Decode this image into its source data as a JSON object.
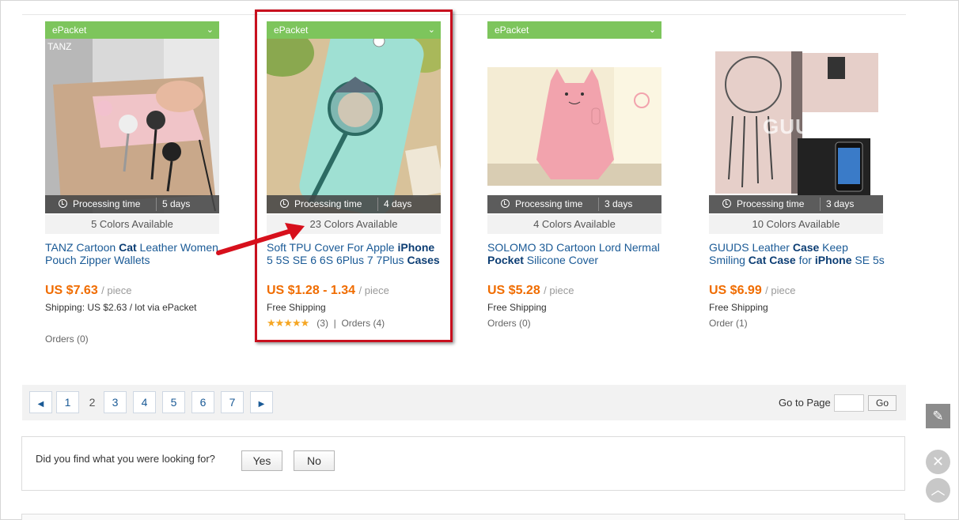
{
  "products": [
    {
      "badge": "ePacket",
      "processing_label": "Processing time",
      "processing_days": "5 days",
      "colors": "5 Colors Available",
      "title_parts": [
        {
          "text": "TANZ Cartoon ",
          "bold": false
        },
        {
          "text": "Cat",
          "bold": true
        },
        {
          "text": " Leather Women Pouch Zipper Wallets",
          "bold": false
        }
      ],
      "price": "US $7.63",
      "unit": "/ piece",
      "shipping": "Shipping: US $2.63 / lot via ePacket",
      "orders": "Orders (0)",
      "image_brand_text": "TANZ"
    },
    {
      "badge": "ePacket",
      "processing_label": "Processing time",
      "processing_days": "4 days",
      "colors": "23 Colors Available",
      "title_parts": [
        {
          "text": "Soft TPU Cover For Apple ",
          "bold": false
        },
        {
          "text": "iPhone",
          "bold": true
        },
        {
          "text": " 5 5S SE 6 6S 6Plus 7 7Plus ",
          "bold": false
        },
        {
          "text": "Cases",
          "bold": true
        }
      ],
      "price": "US $1.28 - 1.34",
      "unit": "/ piece",
      "shipping": "Free Shipping",
      "stars": "★★★★★",
      "rating_count": "(3)",
      "rating_separator": "|",
      "orders": "Orders (4)"
    },
    {
      "badge": "ePacket",
      "processing_label": "Processing time",
      "processing_days": "3 days",
      "colors": "4 Colors Available",
      "title_parts": [
        {
          "text": "SOLOMO 3D Cartoon Lord Nermal ",
          "bold": false
        },
        {
          "text": "Pocket",
          "bold": true
        },
        {
          "text": " Silicone Cover",
          "bold": false
        }
      ],
      "price": "US $5.28",
      "unit": "/ piece",
      "shipping": "Free Shipping",
      "orders": "Orders (0)"
    },
    {
      "processing_label": "Processing time",
      "processing_days": "3 days",
      "colors": "10 Colors Available",
      "title_parts": [
        {
          "text": "GUUDS Leather ",
          "bold": false
        },
        {
          "text": "Case",
          "bold": true
        },
        {
          "text": " Keep Smiling ",
          "bold": false
        },
        {
          "text": "Cat Case",
          "bold": true
        },
        {
          "text": " for ",
          "bold": false
        },
        {
          "text": "iPhone",
          "bold": true
        },
        {
          "text": " SE 5s",
          "bold": false
        }
      ],
      "price": "US $6.99",
      "unit": "/ piece",
      "shipping": "Free Shipping",
      "orders": "Order (1)",
      "image_brand_text": "GUUDS"
    }
  ],
  "pagination": {
    "prev_icon": "triangle-left-icon",
    "next_icon": "triangle-right-icon",
    "pages": [
      "1",
      "2",
      "3",
      "4",
      "5",
      "6",
      "7"
    ],
    "current": "2",
    "goto_label": "Go to Page",
    "goto_value": "",
    "go_button": "Go"
  },
  "feedback": {
    "question": "Did you find what you were looking for?",
    "yes": "Yes",
    "no": "No"
  },
  "side_tools": {
    "edit_icon": "pencil-icon",
    "close_icon": "close-icon",
    "up_icon": "chevron-up-icon"
  },
  "colors": {
    "badge_green": "#7dc55c",
    "price_orange": "#f06c00",
    "link_blue": "#1a5a96",
    "highlight_red": "#c8101e",
    "star_gold": "#f5a623"
  }
}
